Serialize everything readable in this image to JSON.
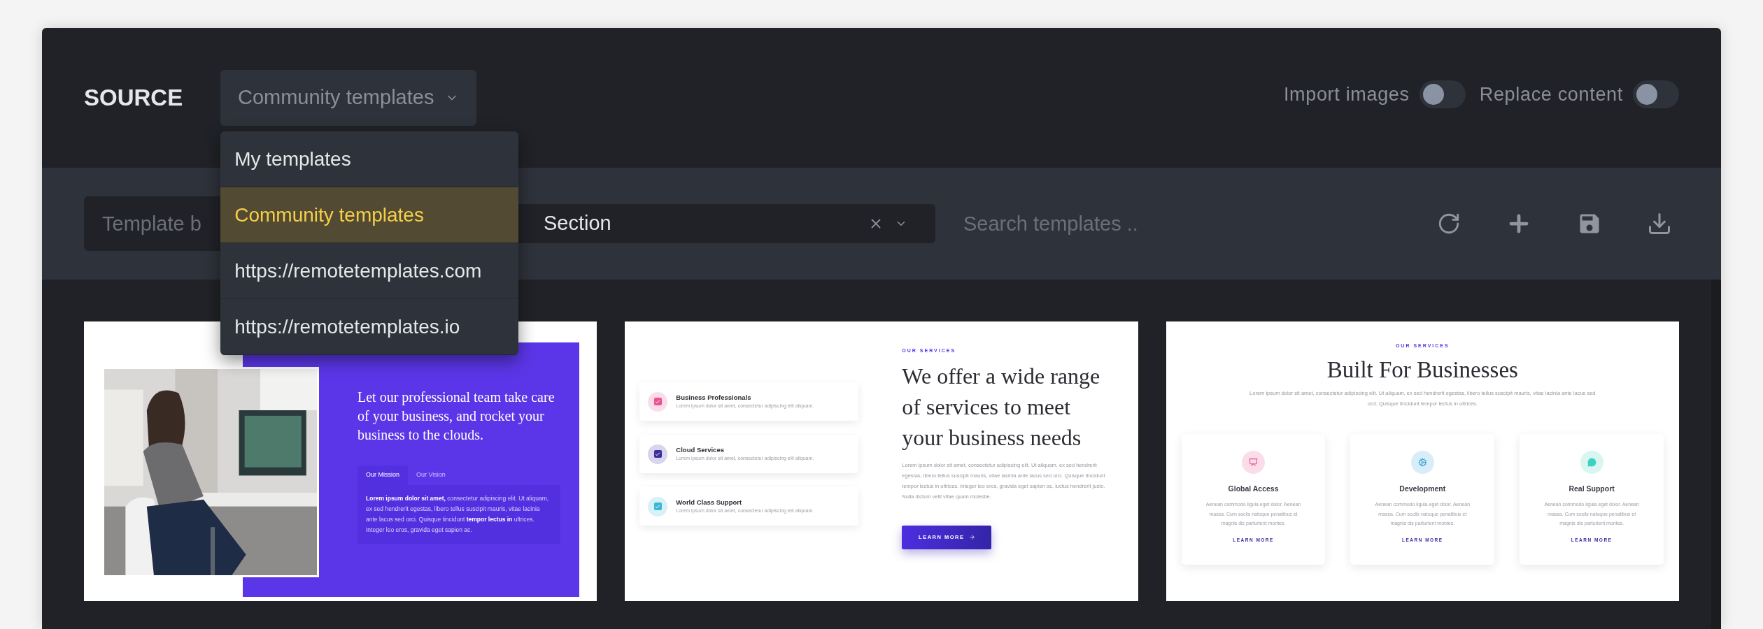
{
  "header": {
    "title": "SOURCE",
    "source_select": {
      "value": "Community templates"
    },
    "dropdown": [
      {
        "label": "My templates",
        "selected": false
      },
      {
        "label": "Community templates",
        "selected": true
      },
      {
        "label": "https://remotetemplates.com",
        "selected": false
      },
      {
        "label": "https://remotetemplates.io",
        "selected": false
      }
    ],
    "toggles": [
      {
        "label": "Import images",
        "on": false
      },
      {
        "label": "Replace content",
        "on": false
      }
    ]
  },
  "toolbar": {
    "template_field": {
      "placeholder": "Template b"
    },
    "type_select": {
      "value": "Section"
    },
    "search": {
      "placeholder": "Search templates .."
    }
  },
  "templates": [
    {
      "kind": "about",
      "heading": "Let our professional team take care of your business, and rocket your business to the clouds.",
      "tabs": [
        {
          "label": "Our Mission",
          "selected": true
        },
        {
          "label": "Our Vision",
          "selected": false
        }
      ],
      "text": "**Lorem ipsum dolor sit amet,** consectetur adipiscing elit. Ut aliquam, ex sed hendrerit egestas, libero tellus suscipit mauris, vitae lacinia ante lacus sed orci. Quisque tincidunt **tempor lectus in** ultrices. Integer leo eros, gravida eget sapien ac."
    },
    {
      "kind": "services_list",
      "eyebrow": "OUR SERVICES",
      "heading": "We offer a wide range of services to meet your business needs",
      "features": [
        {
          "title": "Business Professionals",
          "text": "Lorem ipsum dolor sit amet, consectetur adipiscing elit aliquam.",
          "color": "#e9538f"
        },
        {
          "title": "Cloud Services",
          "text": "Lorem ipsum dolor sit amet, consectetur adipiscing elit aliquam.",
          "color": "#3b2fa0"
        },
        {
          "title": "World Class Support",
          "text": "Lorem ipsum dolor sit amet, consectetur adipiscing elit aliquam.",
          "color": "#3bb7d4"
        }
      ],
      "text": "Lorem ipsum dolor sit amet, consectetur adipiscing elit. Ut aliquam, ex sed hendrerit egestas, libero tellus suscipit mauris, vitae lacinia ante lacus sed orci. Quisque tincidunt tempor lectus in ultrices. Integer leo eros, gravida eget sapien ac, luctus hendrerit justo. Nulla dictum velit vitae quam molestie.",
      "button": "LEARN MORE"
    },
    {
      "kind": "services_grid",
      "eyebrow": "OUR SERVICES",
      "heading": "Built For Businesses",
      "text": "Lorem ipsum dolor sit amet, consectetur adipiscing elit. Ut aliquam, ex sed hendrerit egestas, libero tellus suscipit mauris, vitae lacinia ante lacus sed orci. Quisque tincidunt tempor lectus in ultrices.",
      "boxes": [
        {
          "title": "Global Access",
          "text": "Aenean commodo ligula eget dolor. Aenean massa. Cum sociis natoque penatibus et magnis dis parturient montes.",
          "link": "LEARN MORE",
          "color": "#e9538f"
        },
        {
          "title": "Development",
          "text": "Aenean commodo ligula eget dolor. Aenean massa. Cum sociis natoque penatibus et magnis dis parturient montes.",
          "link": "LEARN MORE",
          "color": "#3aa6d6"
        },
        {
          "title": "Real Support",
          "text": "Aenean commodo ligula eget dolor. Aenean massa. Cum sociis natoque penatibus et magnis dis parturient montes.",
          "link": "LEARN MORE",
          "color": "#3fd1c0"
        }
      ]
    }
  ]
}
